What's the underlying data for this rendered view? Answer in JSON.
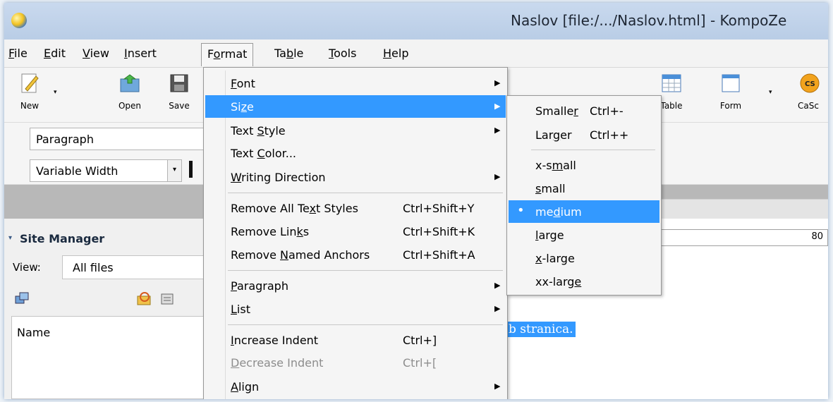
{
  "window": {
    "title": "Naslov [file:/.../Naslov.html] - KompoZe"
  },
  "menubar": [
    {
      "pre": "",
      "u": "F",
      "post": "ile"
    },
    {
      "pre": "",
      "u": "E",
      "post": "dit"
    },
    {
      "pre": "",
      "u": "V",
      "post": "iew"
    },
    {
      "pre": "",
      "u": "I",
      "post": "nsert"
    },
    {
      "pre": "F",
      "u": "o",
      "post": "rmat"
    },
    {
      "pre": "Ta",
      "u": "b",
      "post": "le"
    },
    {
      "pre": "",
      "u": "T",
      "post": "ools"
    },
    {
      "pre": "",
      "u": "H",
      "post": "elp"
    }
  ],
  "toolbar": {
    "new": "New",
    "open": "Open",
    "save": "Save",
    "table": "Table",
    "form": "Form",
    "cascades": "CaSc",
    "cascades_badge": "CS"
  },
  "formatbar": {
    "paragraph": "Paragraph",
    "font": "Variable Width",
    "dropdown_glyph": "▾"
  },
  "site_manager": {
    "title": "Site Manager",
    "view_label": "View:",
    "view_value": "All files",
    "name_header": "Name"
  },
  "ruler": {
    "value": "80"
  },
  "editor": {
    "selected_text": "b stranica."
  },
  "format_menu": {
    "font": {
      "pre": "",
      "u": "F",
      "post": "ont"
    },
    "size": {
      "pre": "Si",
      "u": "z",
      "post": "e"
    },
    "text_style": {
      "pre": "Text ",
      "u": "S",
      "post": "tyle"
    },
    "text_color": {
      "pre": "Text ",
      "u": "C",
      "post": "olor..."
    },
    "writing_direction": {
      "pre": "",
      "u": "W",
      "post": "riting Direction"
    },
    "remove_all_styles": {
      "pre": "Remove All Te",
      "u": "x",
      "post": "t Styles",
      "shortcut": "Ctrl+Shift+Y"
    },
    "remove_links": {
      "pre": "Remove Lin",
      "u": "k",
      "post": "s",
      "shortcut": "Ctrl+Shift+K"
    },
    "remove_anchors": {
      "pre": "Remove ",
      "u": "N",
      "post": "amed Anchors",
      "shortcut": "Ctrl+Shift+A"
    },
    "paragraph": {
      "pre": "",
      "u": "P",
      "post": "aragraph"
    },
    "list": {
      "pre": "",
      "u": "L",
      "post": "ist"
    },
    "increase_indent": {
      "pre": "",
      "u": "I",
      "post": "ncrease Indent",
      "shortcut": "Ctrl+]"
    },
    "decrease_indent": {
      "pre": "",
      "u": "D",
      "post": "ecrease Indent",
      "shortcut": "Ctrl+["
    },
    "align": {
      "pre": "",
      "u": "A",
      "post": "lign"
    }
  },
  "size_menu": {
    "smaller": {
      "pre": "Smalle",
      "u": "r",
      "post": "",
      "shortcut": "Ctrl+-"
    },
    "larger": {
      "pre": "Lar",
      "u": "g",
      "post": "er",
      "shortcut": "Ctrl++"
    },
    "x_small": {
      "pre": "x-s",
      "u": "m",
      "post": "all"
    },
    "small": {
      "pre": "",
      "u": "s",
      "post": "mall"
    },
    "medium": {
      "pre": "me",
      "u": "d",
      "post": "ium"
    },
    "large": {
      "pre": "",
      "u": "l",
      "post": "arge"
    },
    "x_large": {
      "pre": "",
      "u": "x",
      "post": "-large"
    },
    "xx_large": {
      "pre": "xx-larg",
      "u": "e",
      "post": ""
    }
  },
  "colors": {
    "highlight": "#3399ff",
    "title_bar": "#c9d9ee",
    "menu_bg": "#f5f5f5"
  }
}
